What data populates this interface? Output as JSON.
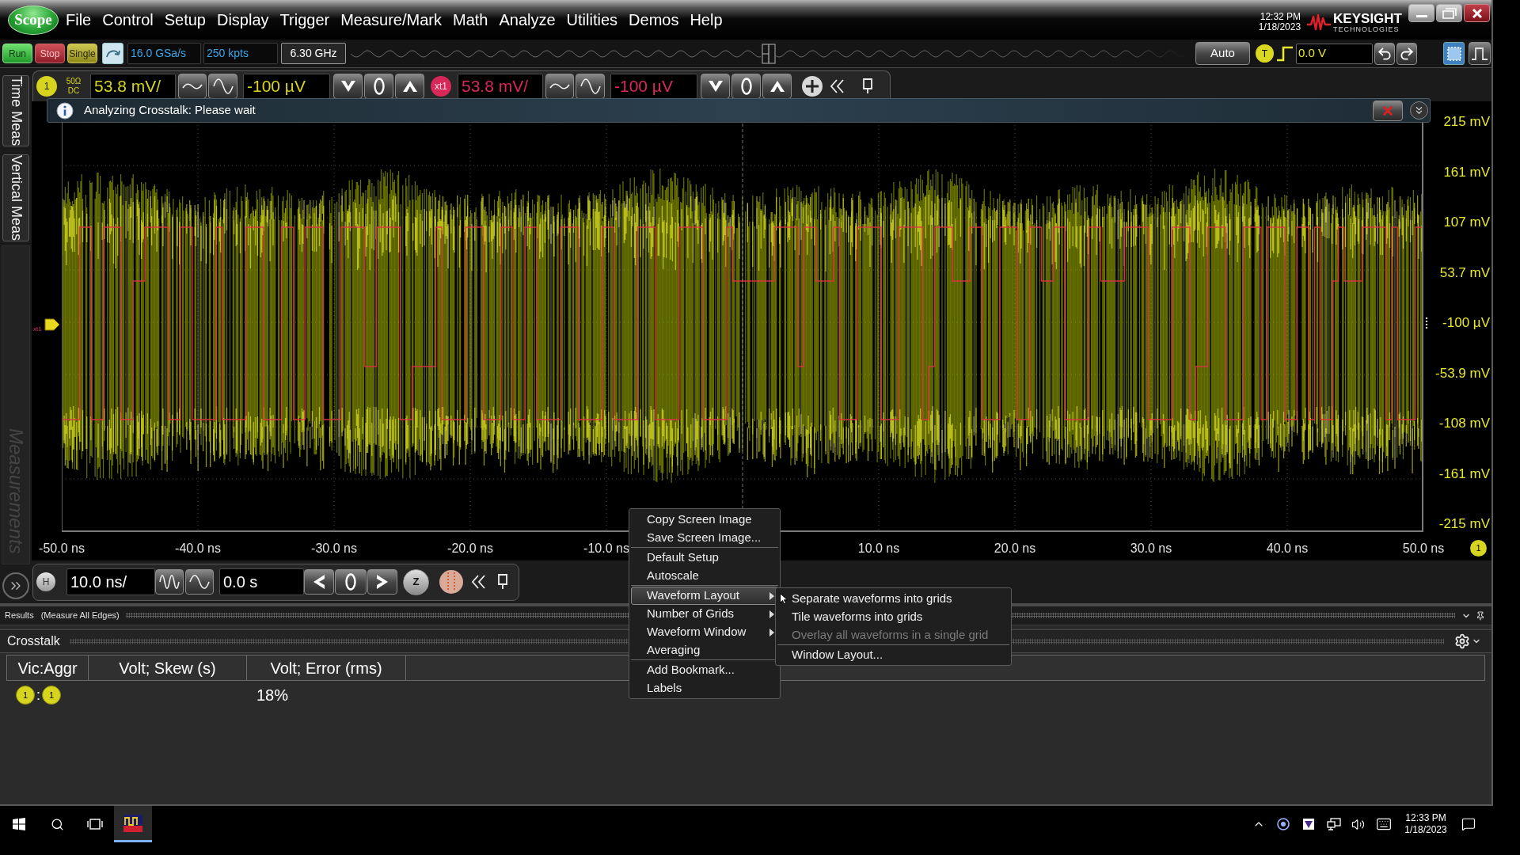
{
  "window": {
    "app_badge": "Scope",
    "menu": [
      "File",
      "Control",
      "Setup",
      "Display",
      "Trigger",
      "Measure/Mark",
      "Math",
      "Analyze",
      "Utilities",
      "Demos",
      "Help"
    ],
    "clock": {
      "time": "12:32 PM",
      "date": "1/18/2023"
    },
    "brand": {
      "name": "KEYSIGHT",
      "tagline": "TECHNOLOGIES"
    }
  },
  "toolbar": {
    "run_controls": [
      {
        "label": "Run",
        "kind": "run"
      },
      {
        "label": "Stop",
        "kind": "stop"
      },
      {
        "label": "Single",
        "kind": "single"
      }
    ],
    "sample_rate": "16.0 GSa/s",
    "memory_depth": "250 kpts",
    "bandwidth": "6.30 GHz",
    "trigger_mode": "Auto",
    "trigger_badge": "T",
    "trigger_level": "0.0 V"
  },
  "side_tabs": [
    {
      "label": "Time Meas",
      "disabled": false
    },
    {
      "label": "Vertical Meas",
      "disabled": false
    },
    {
      "label": "Measurements",
      "disabled": true
    }
  ],
  "channels": [
    {
      "badge": "1",
      "color": "#d6d41e",
      "coupling": [
        "50Ω",
        "DC"
      ],
      "scale": "53.8 mV/",
      "offset": "-100 µV"
    },
    {
      "badge": "xt1",
      "color": "#d8285a",
      "scale": "53.8 mV/",
      "offset": "-100 µV"
    }
  ],
  "notice": "Analyzing Crosstalk: Please wait",
  "plot": {
    "trigger_marker": "xt1",
    "y_labels": [
      "215 mV",
      "161 mV",
      "107 mV",
      "53.7 mV",
      "-100 µV",
      "-53.9 mV",
      "-108 mV",
      "-161 mV",
      "-215 mV"
    ],
    "x_labels": [
      "-50.0 ns",
      "-40.0 ns",
      "-30.0 ns",
      "-20.0 ns",
      "-10.0 ns",
      "10.0 ns",
      "20.0 ns",
      "30.0 ns",
      "40.0 ns",
      "50.0 ns"
    ],
    "channel_marker": "1"
  },
  "horizontal": {
    "badge": "H",
    "scale": "10.0 ns/",
    "position": "0.0 s",
    "zoom": "Z"
  },
  "results": {
    "title": "Results",
    "mode": "(Measure All Edges)",
    "panel_title": "Crosstalk",
    "columns": [
      {
        "label": "Vic:Aggr",
        "kind": "pair"
      },
      {
        "label": "Volt; Skew (s)",
        "kind": "skew"
      },
      {
        "label": "Volt; Error (rms)",
        "kind": "error"
      }
    ],
    "rows": [
      {
        "pair": {
          "victim": "1",
          "separator": ":",
          "aggressor": "1"
        },
        "error": "18%"
      }
    ]
  },
  "context_menu": {
    "items": [
      {
        "kind": "item",
        "label": "Copy Screen Image",
        "submenu": false,
        "selected": false
      },
      {
        "kind": "item",
        "label": "Save Screen Image...",
        "submenu": false,
        "selected": false
      },
      {
        "kind": "separator"
      },
      {
        "kind": "item",
        "label": "Default Setup",
        "submenu": false,
        "selected": false
      },
      {
        "kind": "item",
        "label": "Autoscale",
        "submenu": false,
        "selected": false
      },
      {
        "kind": "separator"
      },
      {
        "kind": "item",
        "label": "Waveform Layout",
        "submenu": true,
        "selected": true
      },
      {
        "kind": "item",
        "label": "Number of Grids",
        "submenu": true,
        "selected": false
      },
      {
        "kind": "item",
        "label": "Waveform Window",
        "submenu": true,
        "selected": false
      },
      {
        "kind": "item",
        "label": "Averaging",
        "submenu": false,
        "selected": false
      },
      {
        "kind": "separator"
      },
      {
        "kind": "item",
        "label": "Add Bookmark...",
        "submenu": false,
        "selected": false
      },
      {
        "kind": "item",
        "label": "Labels",
        "submenu": false,
        "selected": false
      }
    ],
    "submenu": {
      "items": [
        {
          "kind": "item",
          "label": "Separate waveforms into grids",
          "disabled": false
        },
        {
          "kind": "item",
          "label": "Tile waveforms into grids",
          "disabled": false
        },
        {
          "kind": "item",
          "label": "Overlay all waveforms in a single grid",
          "disabled": true
        },
        {
          "kind": "separator"
        },
        {
          "kind": "item",
          "label": "Window Layout...",
          "disabled": false
        }
      ]
    }
  },
  "taskbar": {
    "clock": {
      "time": "12:33 PM",
      "date": "1/18/2023"
    }
  }
}
